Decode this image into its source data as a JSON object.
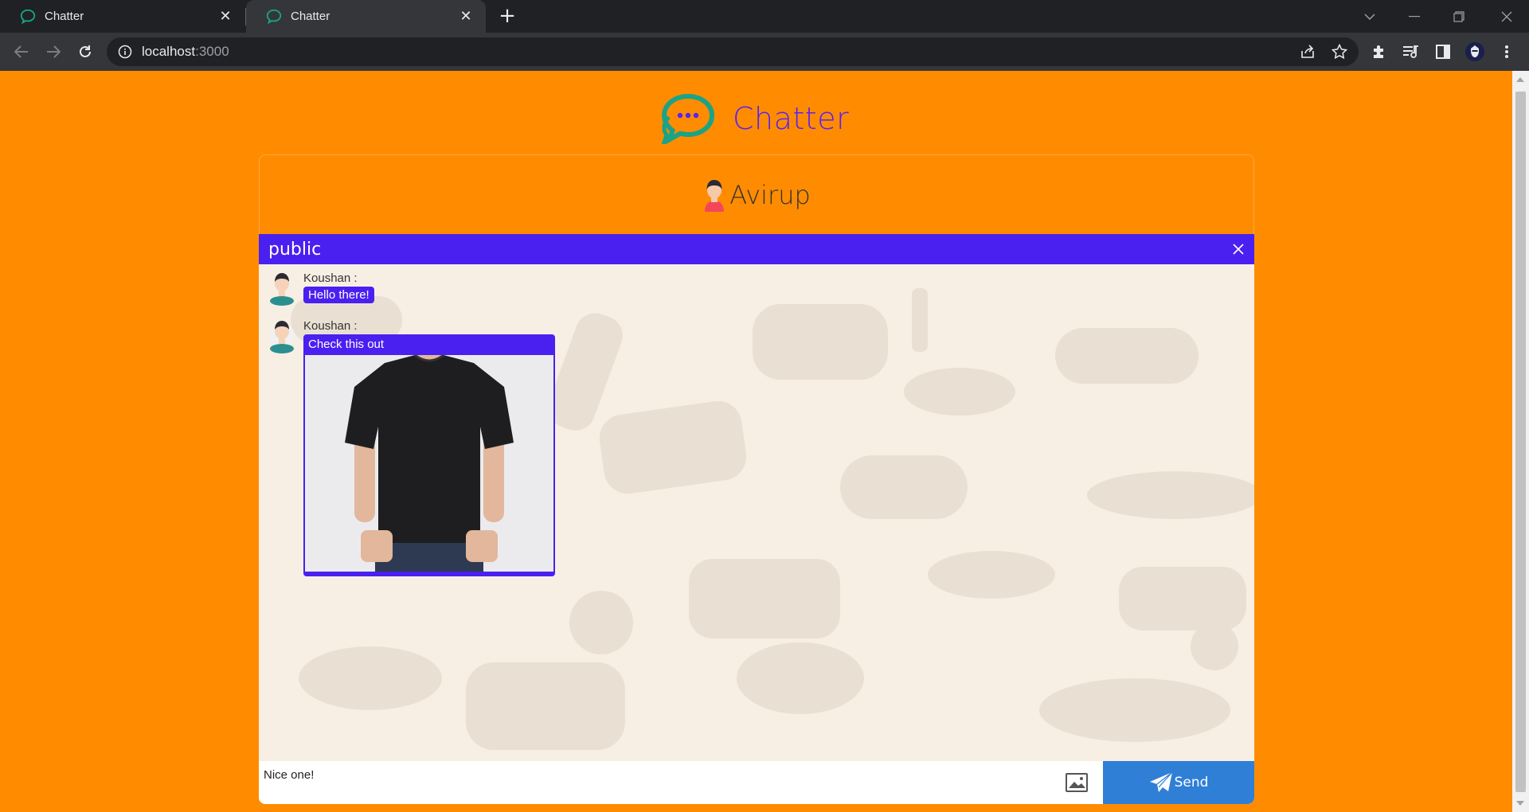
{
  "browser": {
    "tabs": [
      {
        "title": "Chatter",
        "active": false
      },
      {
        "title": "Chatter",
        "active": true
      }
    ],
    "address": {
      "host": "localhost",
      "port": ":3000"
    }
  },
  "app": {
    "brand": "Chatter",
    "current_user": "Avirup",
    "room": {
      "name": "public"
    },
    "messages": [
      {
        "sender": "Koushan :",
        "text": "Hello there!"
      },
      {
        "sender": "Koushan :",
        "text": "Check this out",
        "image": "black-tshirt-photo"
      }
    ],
    "composer": {
      "value": "Nice one!",
      "send_label": "Send"
    }
  },
  "colors": {
    "page_bg": "#ff8c00",
    "accent": "#4a20f0",
    "send": "#2f7fd6",
    "logo": "#1aa386"
  }
}
